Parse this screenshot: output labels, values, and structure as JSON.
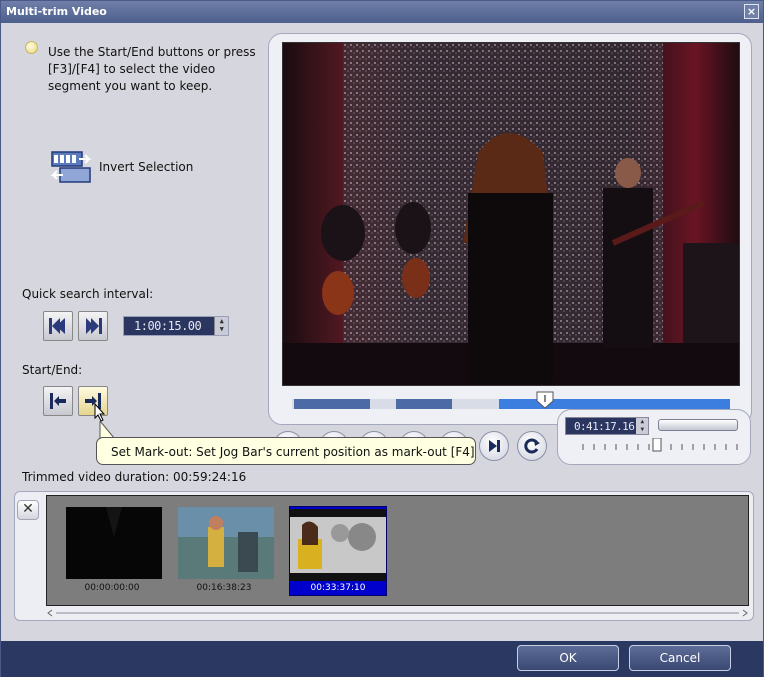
{
  "window": {
    "title": "Multi-trim Video",
    "close_glyph": "×"
  },
  "hint": {
    "icon": "lightbulb-icon",
    "text": "Use the Start/End buttons or press [F3]/[F4] to select the video segment you want to keep."
  },
  "invert": {
    "icon": "invert-selection-icon",
    "label": "Invert Selection"
  },
  "quick_search": {
    "label": "Quick search interval:",
    "time_value": "1:00:15.00"
  },
  "start_end": {
    "label": "Start/End:"
  },
  "tooltip": {
    "text": "Set Mark-out: Set Jog Bar's current position as mark-out [F4]"
  },
  "timecode": {
    "value": "0:41:17.16"
  },
  "trimmed": {
    "label": "Trimmed video duration:",
    "value": "00:59:24:16"
  },
  "clips": [
    {
      "time": "00:00:00:00",
      "selected": false
    },
    {
      "time": "00:16:38:23",
      "selected": false
    },
    {
      "time": "00:33:37:10",
      "selected": true
    }
  ],
  "buttons": {
    "ok": "OK",
    "cancel": "Cancel"
  },
  "colors": {
    "title_bar": "#5a6a98",
    "bottom_bar": "#2b3862",
    "jog_segment_dark": "#4c6aa6",
    "jog_segment_light": "#3c7de0",
    "tooltip_bg": "#ffffe1",
    "selected_clip": "#0000cc"
  }
}
